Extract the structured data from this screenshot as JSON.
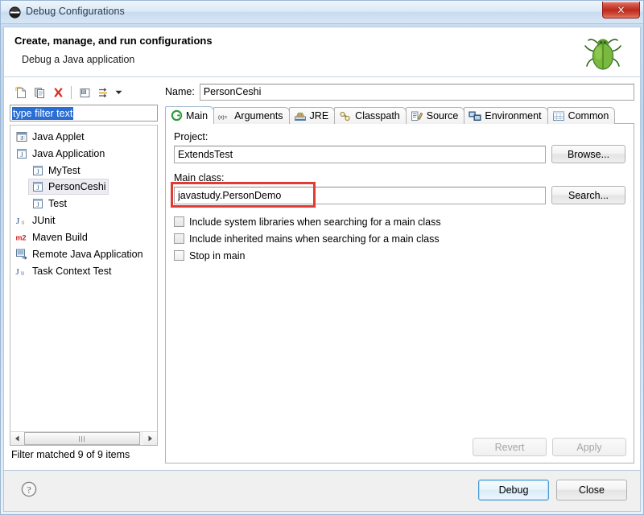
{
  "window": {
    "title": "Debug Configurations",
    "title_icon": "eclipse-debug-icon",
    "close_label": "x"
  },
  "header": {
    "title": "Create, manage, and run configurations",
    "subtitle": "Debug a Java application",
    "icon": "green-bug-icon"
  },
  "toolbar": {
    "buttons": [
      {
        "name": "new-launch-configuration-icon",
        "label": "New launch configuration"
      },
      {
        "name": "duplicate-launch-configuration-icon",
        "label": "Duplicate"
      },
      {
        "name": "delete-launch-configuration-icon",
        "label": "Delete"
      },
      {
        "name": "collapse-all-icon",
        "label": "Collapse All"
      },
      {
        "name": "filter-launch-configurations-icon",
        "label": "Filter launch configurations"
      },
      {
        "name": "view-menu-chevron-down-icon",
        "label": "View Menu"
      }
    ]
  },
  "filter": {
    "value": "type filter text",
    "placeholder": "type filter text",
    "selected": true
  },
  "tree": {
    "items": [
      {
        "label": "Java Applet",
        "icon": "java-applet-icon",
        "level": 0,
        "selected": false
      },
      {
        "label": "Java Application",
        "icon": "java-application-icon",
        "level": 0,
        "selected": false
      },
      {
        "label": "MyTest",
        "icon": "java-launch-icon",
        "level": 1,
        "selected": false
      },
      {
        "label": "PersonCeshi",
        "icon": "java-launch-icon",
        "level": 1,
        "selected": true
      },
      {
        "label": "Test",
        "icon": "java-launch-icon",
        "level": 1,
        "selected": false
      },
      {
        "label": "JUnit",
        "icon": "junit-icon",
        "level": 0,
        "selected": false
      },
      {
        "label": "Maven Build",
        "icon": "maven-icon",
        "level": 0,
        "selected": false
      },
      {
        "label": "Remote Java Application",
        "icon": "remote-java-application-icon",
        "level": 0,
        "selected": false
      },
      {
        "label": "Task Context Test",
        "icon": "task-context-test-icon",
        "level": 0,
        "selected": false
      }
    ],
    "status": "Filter matched 9 of 9 items"
  },
  "config": {
    "name_label": "Name:",
    "name_value": "PersonCeshi",
    "tabs": [
      {
        "label": "Main",
        "icon": "main-tab-icon",
        "active": true
      },
      {
        "label": "Arguments",
        "icon": "arguments-tab-icon",
        "active": false
      },
      {
        "label": "JRE",
        "icon": "jre-tab-icon",
        "active": false
      },
      {
        "label": "Classpath",
        "icon": "classpath-tab-icon",
        "active": false
      },
      {
        "label": "Source",
        "icon": "source-tab-icon",
        "active": false
      },
      {
        "label": "Environment",
        "icon": "environment-tab-icon",
        "active": false
      },
      {
        "label": "Common",
        "icon": "common-tab-icon",
        "active": false
      }
    ],
    "project_label": "Project:",
    "project_value": "ExtendsTest",
    "browse_label": "Browse...",
    "main_class_label": "Main class:",
    "main_class_value": "javastudy.PersonDemo",
    "search_label": "Search...",
    "checkboxes": [
      {
        "label": "Include system libraries when searching for a main class",
        "checked": false
      },
      {
        "label": "Include inherited mains when searching for a main class",
        "checked": false
      },
      {
        "label": "Stop in main",
        "checked": false
      }
    ],
    "revert_label": "Revert",
    "apply_label": "Apply",
    "revert_enabled": false,
    "apply_enabled": false
  },
  "footer": {
    "help_icon": "help-question-icon",
    "debug_label": "Debug",
    "close_label": "Close"
  },
  "annotation": {
    "color": "#e23b34",
    "target": "main-class-input"
  }
}
